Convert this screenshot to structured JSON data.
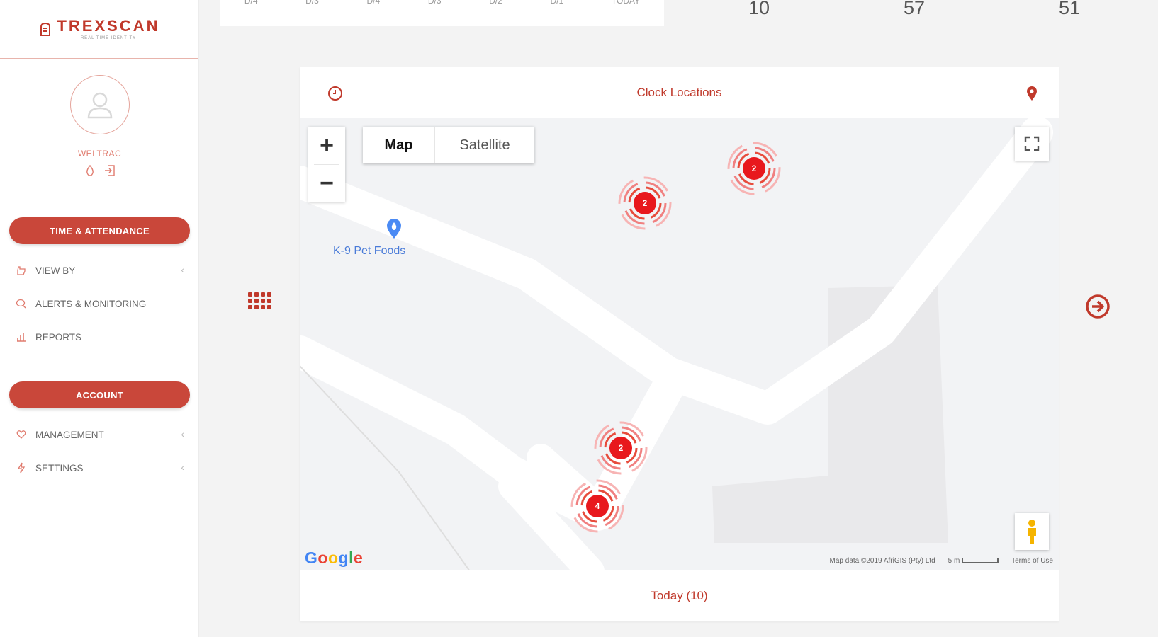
{
  "brand": {
    "name": "TREXSCAN",
    "tagline": "REAL TIME IDENTITY"
  },
  "user": {
    "name": "WELTRAC"
  },
  "sidebar": {
    "section1": "TIME & ATTENDANCE",
    "items1": [
      {
        "label": "VIEW BY",
        "icon": "hand-icon"
      },
      {
        "label": "ALERTS & MONITORING",
        "icon": "chat-icon"
      },
      {
        "label": "REPORTS",
        "icon": "bar-chart-icon"
      }
    ],
    "section2": "ACCOUNT",
    "items2": [
      {
        "label": "MANAGEMENT",
        "icon": "heart-hand-icon"
      },
      {
        "label": "SETTINGS",
        "icon": "lightning-icon"
      }
    ]
  },
  "top": {
    "ticks": [
      "D/4",
      "D/3",
      "D/4",
      "D/3",
      "D/2",
      "D/1",
      "TODAY"
    ],
    "stats": [
      "10",
      "57",
      "51"
    ]
  },
  "map_card": {
    "title": "Clock Locations",
    "footer": "Today (10)",
    "map_type": {
      "map": "Map",
      "satellite": "Satellite"
    },
    "zoom_in": "+",
    "zoom_out": "−",
    "poi_label": "K-9 Pet Foods",
    "attribution": "Map data ©2019 AfriGIS (Pty) Ltd",
    "scale": "5 m",
    "terms": "Terms of Use",
    "clusters": [
      "2",
      "2",
      "2",
      "4"
    ]
  },
  "colors": {
    "accent": "#c9473a",
    "map_bg": "#f2f3f5"
  }
}
